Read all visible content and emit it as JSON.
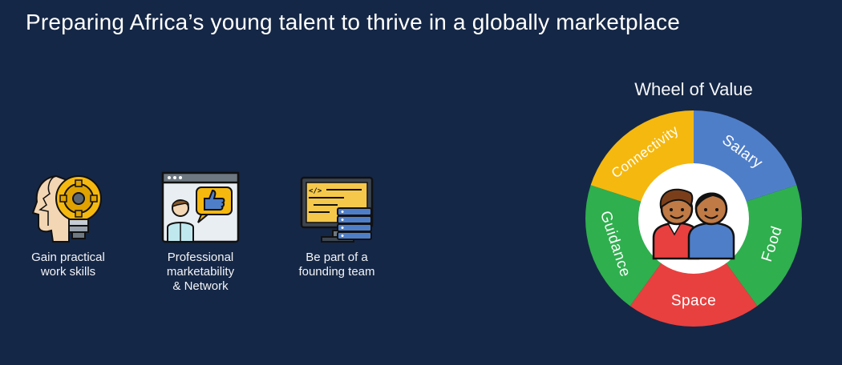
{
  "title": "Preparing Africa’s young talent to thrive in a globally marketplace",
  "benefits": [
    {
      "label": "Gain practical\nwork skills",
      "icon": "head-gear-bulb-icon"
    },
    {
      "label": "Professional\nmarketability\n& Network",
      "icon": "presentation-thumbs-up-icon"
    },
    {
      "label": "Be part of a\nfounding team",
      "icon": "code-server-monitor-icon"
    }
  ],
  "wheel": {
    "title": "Wheel of Value",
    "segments": [
      {
        "label": "Salary",
        "color": "#4f7ec9"
      },
      {
        "label": "Food",
        "color": "#2faf4e"
      },
      {
        "label": "Space",
        "color": "#e8403f"
      },
      {
        "label": "Guidance",
        "color": "#2faf4e"
      },
      {
        "label": "Connectivity",
        "color": "#f5b80f"
      }
    ],
    "center_icon": "two-people-icon"
  }
}
